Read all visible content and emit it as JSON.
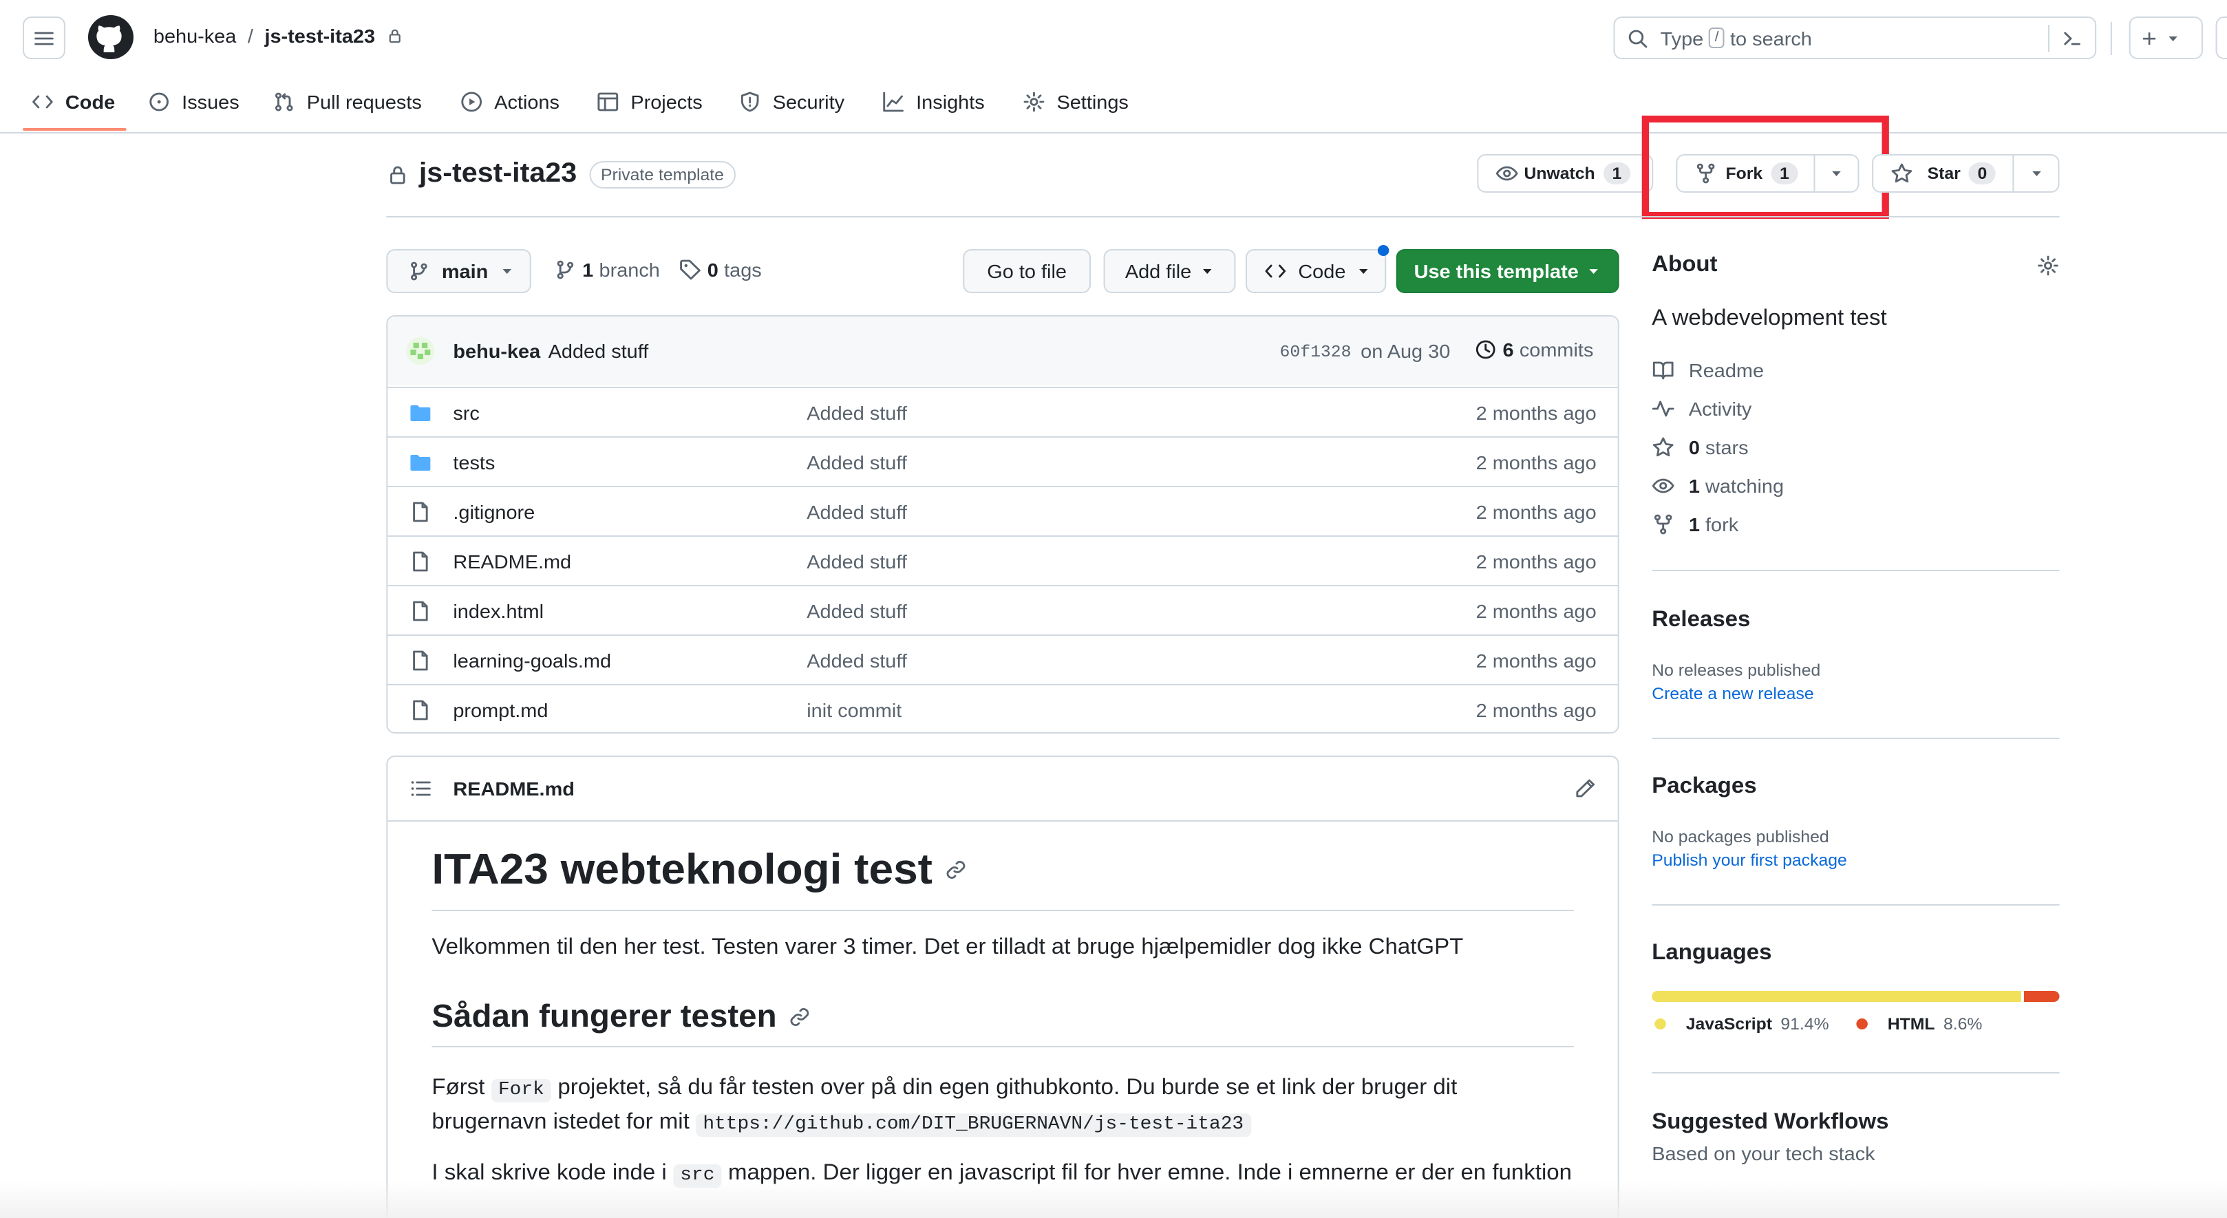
{
  "header": {
    "owner": "behu-kea",
    "separator": "/",
    "repo": "js-test-ita23",
    "search_prefix": "Type",
    "search_key": "/",
    "search_suffix": "to search",
    "plus": "+"
  },
  "nav": {
    "tabs": [
      {
        "label": "Code"
      },
      {
        "label": "Issues"
      },
      {
        "label": "Pull requests"
      },
      {
        "label": "Actions"
      },
      {
        "label": "Projects"
      },
      {
        "label": "Security"
      },
      {
        "label": "Insights"
      },
      {
        "label": "Settings"
      }
    ]
  },
  "repo": {
    "name": "js-test-ita23",
    "badge": "Private template",
    "unwatch_label": "Unwatch",
    "unwatch_count": "1",
    "fork_label": "Fork",
    "fork_count": "1",
    "star_label": "Star",
    "star_count": "0"
  },
  "toolbar": {
    "branch": "main",
    "branch_count": "1",
    "branch_word": "branch",
    "tag_count": "0",
    "tag_word": "tags",
    "go_to_file": "Go to file",
    "add_file": "Add file",
    "code": "Code",
    "use_template": "Use this template"
  },
  "commit": {
    "author": "behu-kea",
    "message": "Added stuff",
    "sha": "60f1328",
    "date": "on Aug 30",
    "count": "6",
    "count_word": "commits"
  },
  "files": [
    {
      "name": "src",
      "type": "folder",
      "message": "Added stuff",
      "age": "2 months ago"
    },
    {
      "name": "tests",
      "type": "folder",
      "message": "Added stuff",
      "age": "2 months ago"
    },
    {
      "name": ".gitignore",
      "type": "file",
      "message": "Added stuff",
      "age": "2 months ago"
    },
    {
      "name": "README.md",
      "type": "file",
      "message": "Added stuff",
      "age": "2 months ago"
    },
    {
      "name": "index.html",
      "type": "file",
      "message": "Added stuff",
      "age": "2 months ago"
    },
    {
      "name": "learning-goals.md",
      "type": "file",
      "message": "Added stuff",
      "age": "2 months ago"
    },
    {
      "name": "prompt.md",
      "type": "file",
      "message": "init commit",
      "age": "2 months ago"
    }
  ],
  "readme": {
    "filename": "README.md",
    "h1": "ITA23 webteknologi test",
    "intro": "Velkommen til den her test. Testen varer 3 timer. Det er tilladt at bruge hjælpemidler dog ikke ChatGPT",
    "h2": "Sådan fungerer testen",
    "p1_a": "Først",
    "p1_code": "Fork",
    "p1_b": "projektet, så du får testen over på din egen githubkonto. Du burde se et link der bruger dit",
    "p1_c": "brugernavn istedet for mit",
    "p1_url": "https://github.com/DIT_BRUGERNAVN/js-test-ita23",
    "p2_a": "I skal skrive kode inde i",
    "p2_code": "src",
    "p2_b": "mappen. Der ligger en javascript fil for hver emne. Inde i emnerne er der en funktion"
  },
  "sidebar": {
    "about_title": "About",
    "description": "A webdevelopment test",
    "links": [
      {
        "label": "Readme",
        "icon": "book-icon"
      },
      {
        "label": "Activity",
        "icon": "pulse-icon"
      },
      {
        "count": "0",
        "label": "stars",
        "icon": "star-icon"
      },
      {
        "count": "1",
        "label": "watching",
        "icon": "eye-icon"
      },
      {
        "count": "1",
        "label": "fork",
        "icon": "fork-icon"
      }
    ],
    "releases_title": "Releases",
    "releases_empty": "No releases published",
    "releases_link": "Create a new release",
    "packages_title": "Packages",
    "packages_empty": "No packages published",
    "packages_link": "Publish your first package",
    "languages_title": "Languages",
    "languages": [
      {
        "name": "JavaScript",
        "percent": "91.4%",
        "share": 91.4,
        "color": "#f1e05a"
      },
      {
        "name": "HTML",
        "percent": "8.6%",
        "share": 8.6,
        "color": "#e34c26"
      }
    ],
    "workflows_title": "Suggested Workflows",
    "workflows_sub": "Based on your tech stack"
  },
  "colors": {
    "accent_green": "#1f883d",
    "highlight_red": "#ee2636",
    "link_blue": "#0969da",
    "folder_blue": "#54aeff"
  }
}
